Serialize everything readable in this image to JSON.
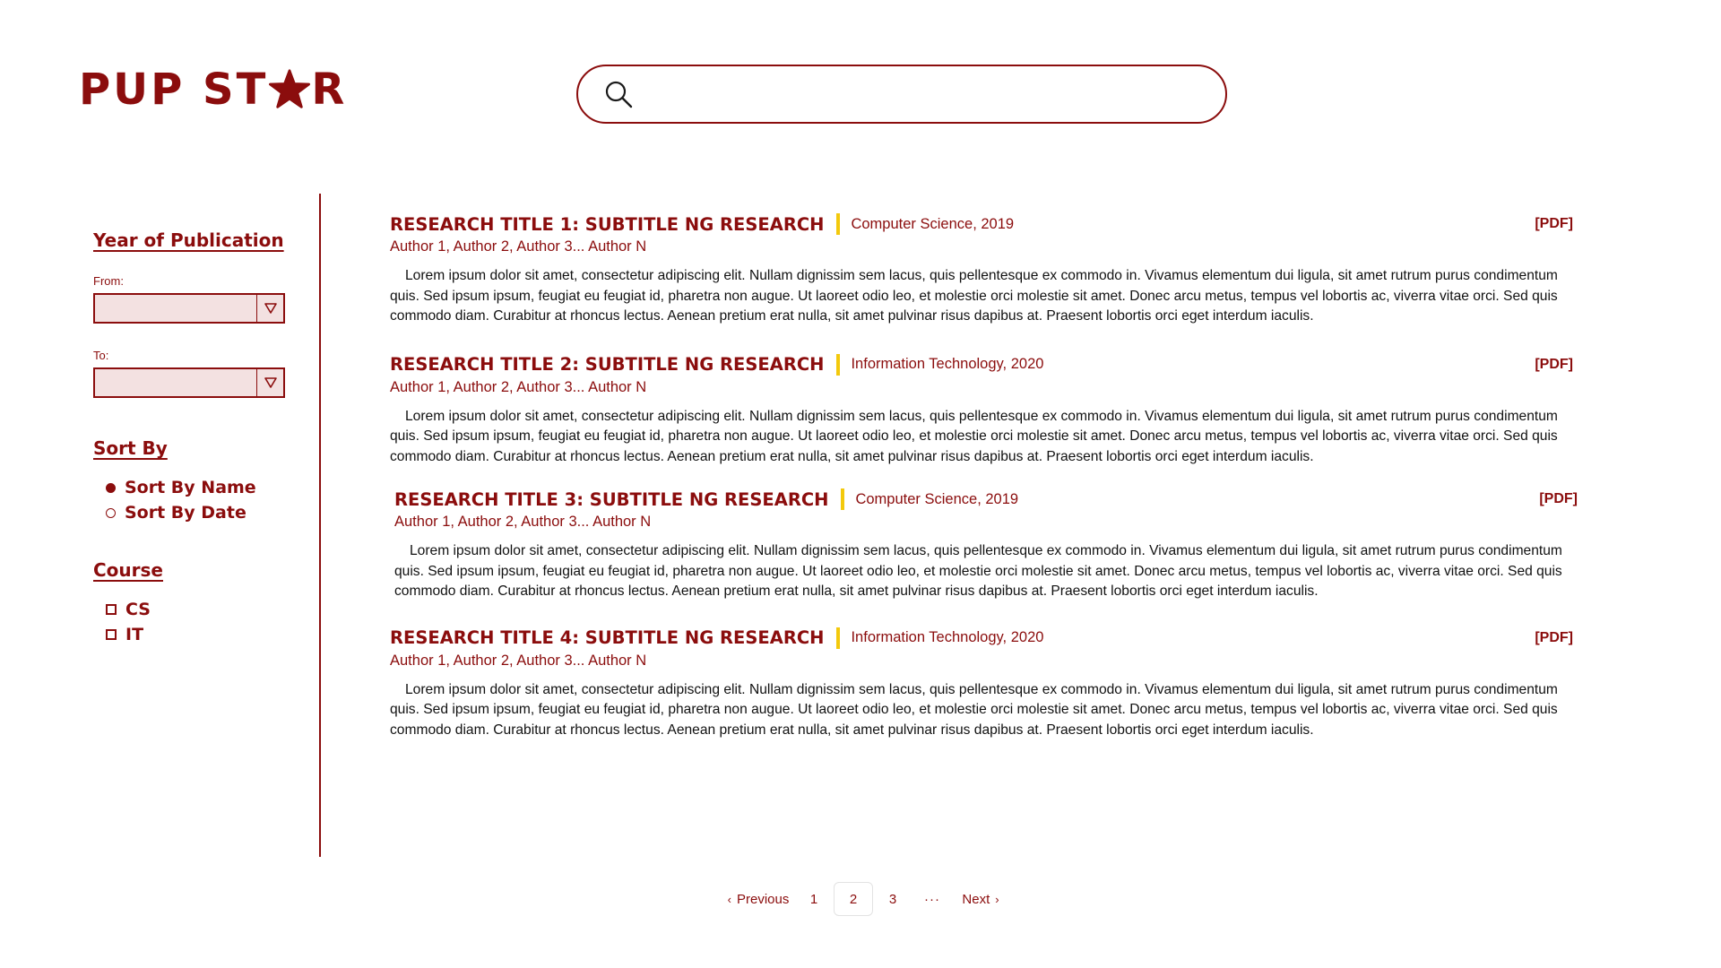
{
  "brand": {
    "logo_left": "PUP ST",
    "logo_right": "R",
    "color": "#8b0d0d"
  },
  "search": {
    "placeholder": "",
    "value": ""
  },
  "filters": {
    "year_heading": "Year of Publication",
    "from_label": "From:",
    "from_value": "",
    "to_label": "To:",
    "to_value": "",
    "sort_heading": "Sort By",
    "sort_options": [
      {
        "label": "Sort By Name",
        "selected": true
      },
      {
        "label": "Sort By Date",
        "selected": false
      }
    ],
    "course_heading": "Course",
    "course_options": [
      {
        "label": "CS",
        "checked": false
      },
      {
        "label": "IT",
        "checked": false
      }
    ]
  },
  "results": [
    {
      "title": "RESEARCH TITLE 1: SUBTITLE NG RESEARCH",
      "meta": "Computer Science, 2019",
      "authors": "Author 1, Author 2, Author 3... Author N",
      "pdf": "[PDF]",
      "abstract": "Lorem ipsum dolor sit amet, consectetur adipiscing elit. Nullam dignissim sem lacus, quis pellentesque ex commodo in. Vivamus elementum dui ligula, sit amet rutrum purus condimentum quis. Sed ipsum ipsum, feugiat eu feugiat id, pharetra non augue. Ut laoreet odio leo, et molestie orci molestie sit amet. Donec arcu metus, tempus vel lobortis ac, viverra vitae orci. Sed quis commodo diam. Curabitur at rhoncus lectus. Aenean pretium erat nulla, sit amet pulvinar risus dapibus at. Praesent lobortis orci eget interdum iaculis."
    },
    {
      "title": "RESEARCH TITLE 2: SUBTITLE NG RESEARCH",
      "meta": "Information Technology, 2020",
      "authors": "Author 1, Author 2, Author 3... Author N",
      "pdf": "[PDF]",
      "abstract": "Lorem ipsum dolor sit amet, consectetur adipiscing elit. Nullam dignissim sem lacus, quis pellentesque ex commodo in. Vivamus elementum dui ligula, sit amet rutrum purus condimentum quis. Sed ipsum ipsum, feugiat eu feugiat id, pharetra non augue. Ut laoreet odio leo, et molestie orci molestie sit amet. Donec arcu metus, tempus vel lobortis ac, viverra vitae orci. Sed quis commodo diam. Curabitur at rhoncus lectus. Aenean pretium erat nulla, sit amet pulvinar risus dapibus at. Praesent lobortis orci eget interdum iaculis."
    },
    {
      "title": "RESEARCH TITLE 3: SUBTITLE NG RESEARCH",
      "meta": "Computer Science, 2019",
      "authors": "Author 1, Author 2, Author 3... Author N",
      "pdf": "[PDF]",
      "abstract": "Lorem ipsum dolor sit amet, consectetur adipiscing elit. Nullam dignissim sem lacus, quis pellentesque ex commodo in. Vivamus elementum dui ligula, sit amet rutrum purus condimentum quis. Sed ipsum ipsum, feugiat eu feugiat id, pharetra non augue. Ut laoreet odio leo, et molestie orci molestie sit amet. Donec arcu metus, tempus vel lobortis ac, viverra vitae orci. Sed quis commodo diam. Curabitur at rhoncus lectus. Aenean pretium erat nulla, sit amet pulvinar risus dapibus at. Praesent lobortis orci eget interdum iaculis."
    },
    {
      "title": "RESEARCH TITLE 4: SUBTITLE NG RESEARCH",
      "meta": "Information Technology, 2020",
      "authors": "Author 1, Author 2, Author 3... Author N",
      "pdf": "[PDF]",
      "abstract": "Lorem ipsum dolor sit amet, consectetur adipiscing elit. Nullam dignissim sem lacus, quis pellentesque ex commodo in. Vivamus elementum dui ligula, sit amet rutrum purus condimentum quis. Sed ipsum ipsum, feugiat eu feugiat id, pharetra non augue. Ut laoreet odio leo, et molestie orci molestie sit amet. Donec arcu metus, tempus vel lobortis ac, viverra vitae orci. Sed quis commodo diam. Curabitur at rhoncus lectus. Aenean pretium erat nulla, sit amet pulvinar risus dapibus at. Praesent lobortis orci eget interdum iaculis."
    }
  ],
  "pagination": {
    "previous": "Previous",
    "pages": [
      "1",
      "2",
      "3"
    ],
    "current": "2",
    "ellipsis": "···",
    "next": "Next"
  },
  "colors": {
    "accent": "#8b0d0d",
    "separator": "#f3c90c",
    "dropdown_fill": "#f3e1e1"
  },
  "icons": {
    "search": "search-icon",
    "star": "star-icon",
    "dropdown": "triangle-down-icon"
  }
}
